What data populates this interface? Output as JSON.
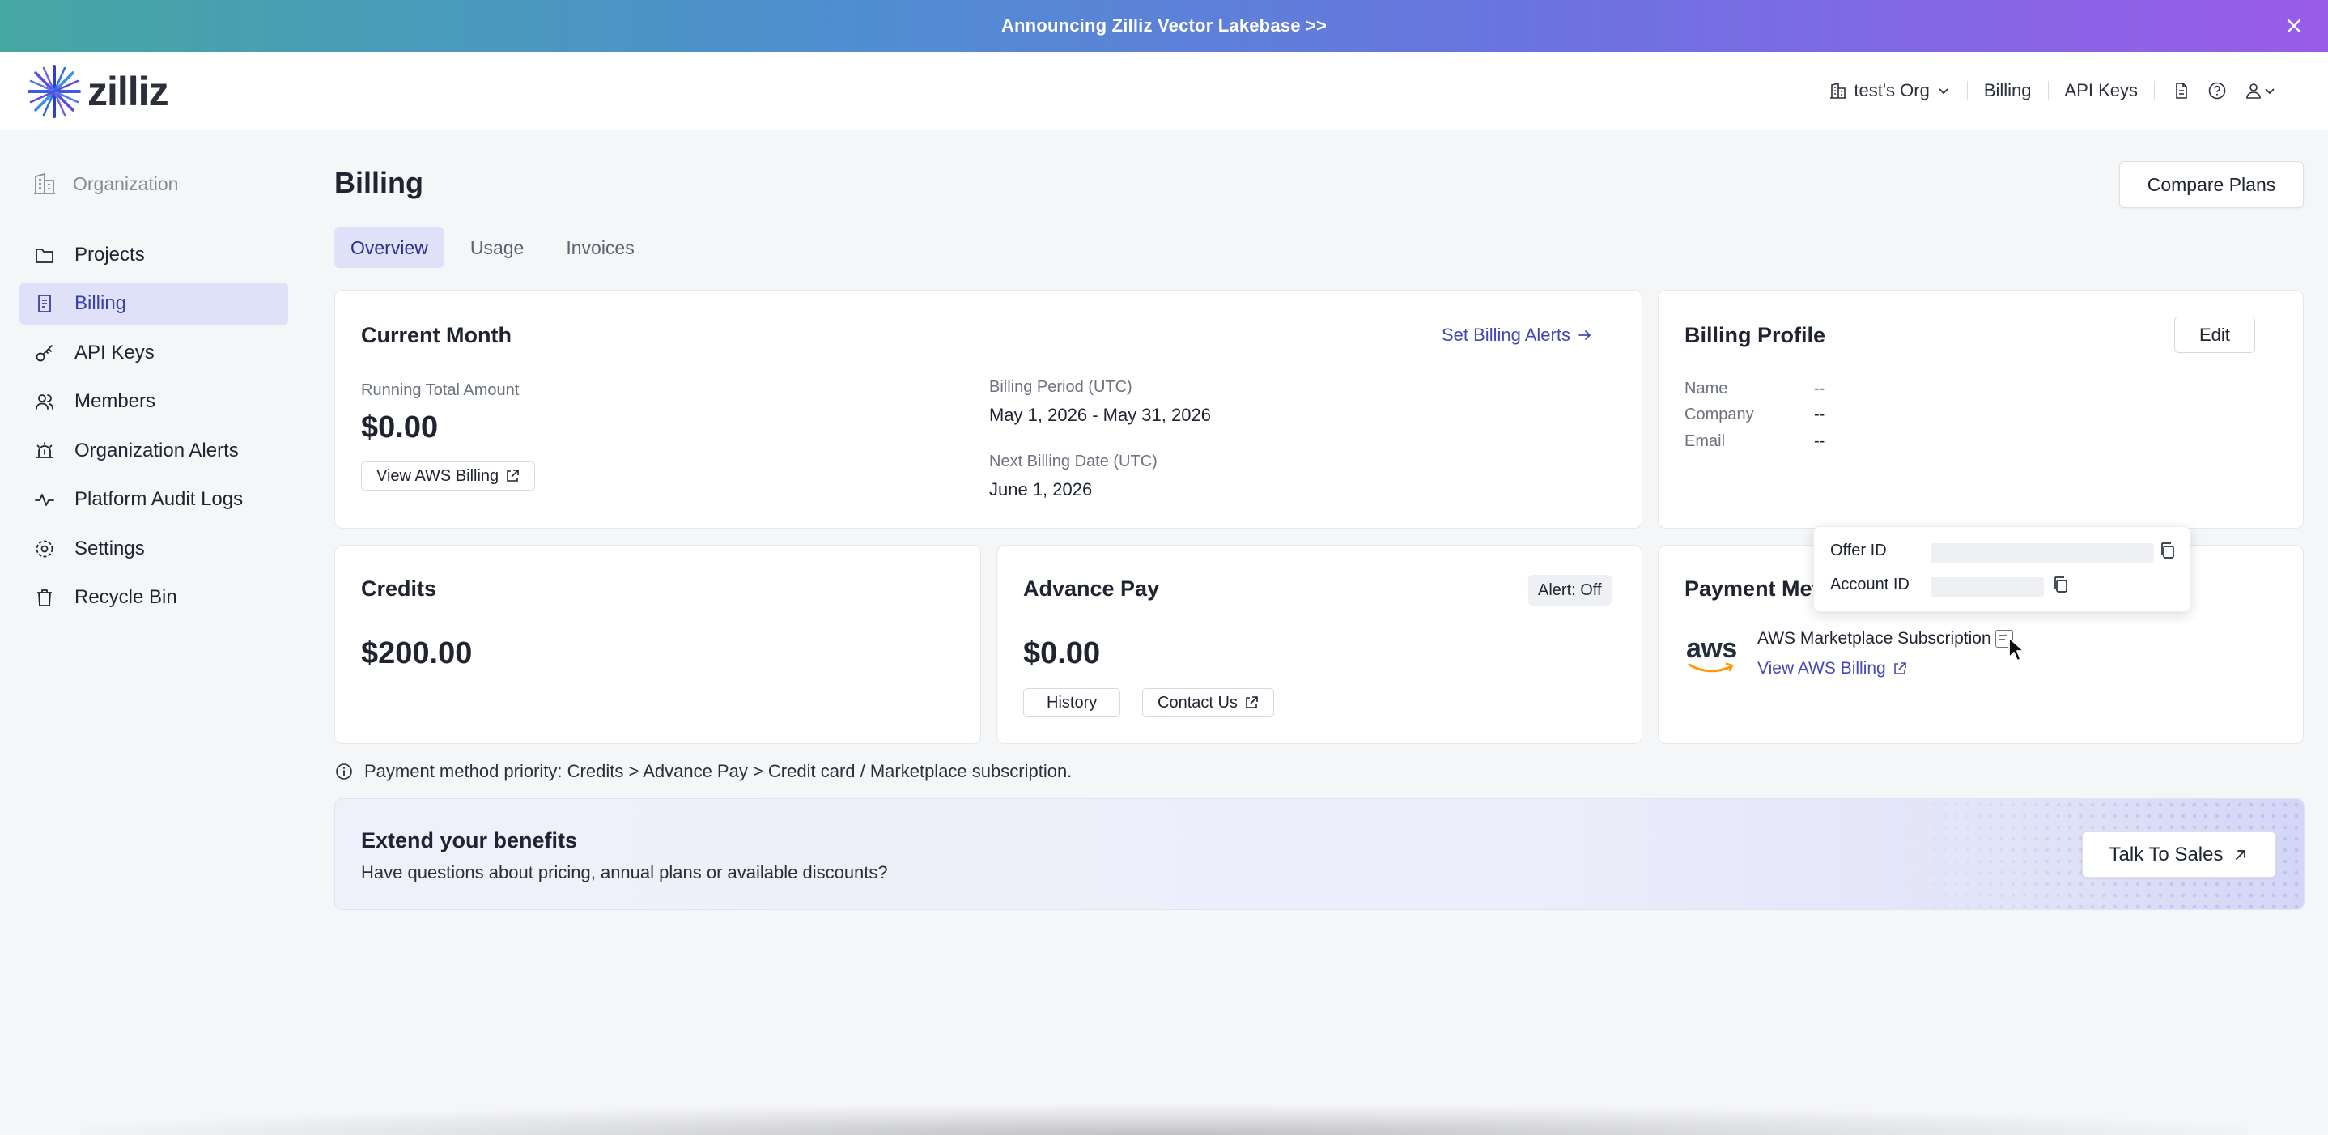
{
  "banner": {
    "text": "Announcing Zilliz Vector Lakebase >>"
  },
  "header": {
    "logo_text": "zilliz",
    "org_label": "test's Org",
    "billing_link": "Billing",
    "api_keys_link": "API Keys"
  },
  "sidebar": {
    "org_label": "Organization",
    "items": [
      {
        "label": "Projects",
        "icon": "folder-icon"
      },
      {
        "label": "Billing",
        "icon": "receipt-icon"
      },
      {
        "label": "API Keys",
        "icon": "key-icon"
      },
      {
        "label": "Members",
        "icon": "users-icon"
      },
      {
        "label": "Organization Alerts",
        "icon": "siren-icon"
      },
      {
        "label": "Platform Audit Logs",
        "icon": "activity-icon"
      },
      {
        "label": "Settings",
        "icon": "gear-icon"
      },
      {
        "label": "Recycle Bin",
        "icon": "trash-icon"
      }
    ]
  },
  "page": {
    "title": "Billing",
    "compare_plans": "Compare Plans",
    "tabs": [
      "Overview",
      "Usage",
      "Invoices"
    ]
  },
  "current_month": {
    "title": "Current Month",
    "set_alerts": "Set Billing Alerts",
    "running_total_label": "Running Total Amount",
    "running_total": "$0.00",
    "view_aws_billing": "View AWS Billing",
    "billing_period_label": "Billing Period (UTC)",
    "billing_period": "May 1, 2026 - May 31, 2026",
    "next_billing_label": "Next Billing Date (UTC)",
    "next_billing": "June 1, 2026"
  },
  "billing_profile": {
    "title": "Billing Profile",
    "edit": "Edit",
    "name_label": "Name",
    "name": "--",
    "company_label": "Company",
    "company": "--",
    "email_label": "Email",
    "email": "--"
  },
  "credits": {
    "title": "Credits",
    "amount": "$200.00"
  },
  "advance_pay": {
    "title": "Advance Pay",
    "alert_badge": "Alert: Off",
    "amount": "$0.00",
    "history": "History",
    "contact_us": "Contact Us"
  },
  "payment_method": {
    "title": "Payment Met",
    "aws_logo": "aws",
    "subscription": "AWS Marketplace Subscription",
    "view_aws_billing": "View AWS Billing"
  },
  "popover": {
    "offer_id_label": "Offer ID",
    "account_id_label": "Account ID"
  },
  "note": {
    "text": "Payment method priority: Credits > Advance Pay > Credit card / Marketplace subscription."
  },
  "benefits": {
    "title": "Extend your benefits",
    "subtitle": "Have questions about pricing, annual plans or available discounts?",
    "talk_to_sales": "Talk To Sales"
  },
  "colors": {
    "accent": "#4348b8",
    "active_bg": "#dfe1f8"
  }
}
